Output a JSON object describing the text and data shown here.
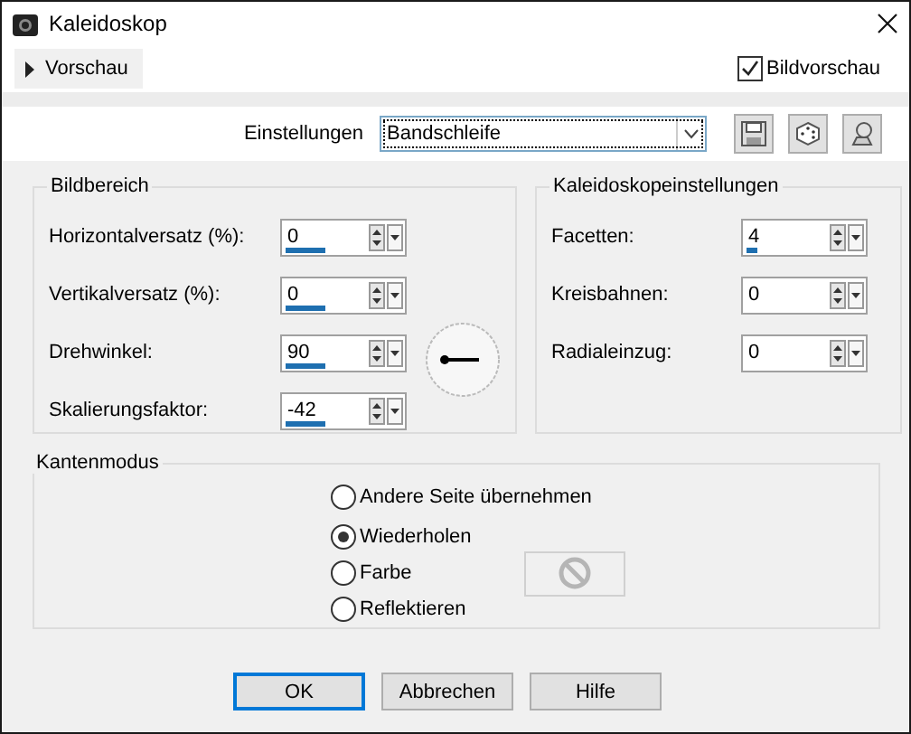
{
  "window": {
    "title": "Kaleidoskop"
  },
  "preview_toggle": {
    "label": "Vorschau",
    "expanded": false
  },
  "image_preview": {
    "label": "Bildvorschau",
    "checked": true
  },
  "presets": {
    "label": "Einstellungen",
    "value": "Bandschleife"
  },
  "image_area": {
    "title": "Bildbereich",
    "fields": [
      {
        "label": "Horizontalversatz (%):",
        "value": "0",
        "kind": "bar"
      },
      {
        "label": "Vertikalversatz (%):",
        "value": "0",
        "kind": "bar"
      },
      {
        "label": "Drehwinkel:",
        "value": "90",
        "kind": "bar"
      },
      {
        "label": "Skalierungsfaktor:",
        "value": "-42",
        "kind": "bar"
      }
    ]
  },
  "kaleidoscope_settings": {
    "title": "Kaleidoskopeinstellungen",
    "fields": [
      {
        "label": "Facetten:",
        "value": "4",
        "level": 0.13
      },
      {
        "label": "Kreisbahnen:",
        "value": "0"
      },
      {
        "label": "Radialeinzug:",
        "value": "0"
      }
    ]
  },
  "edge_mode": {
    "title": "Kantenmodus",
    "options": [
      {
        "label": "Andere Seite übernehmen",
        "selected": false,
        "kind": "plain"
      },
      {
        "label": "Wiederholen",
        "selected": true,
        "kind": "plain"
      },
      {
        "label": "Farbe",
        "selected": false,
        "kind": "color"
      },
      {
        "label": "Reflektieren",
        "selected": false,
        "kind": "plain"
      }
    ]
  },
  "buttons": [
    {
      "label": "OK",
      "default": true
    },
    {
      "label": "Abbrechen",
      "default": false
    },
    {
      "label": "Hilfe",
      "default": false
    }
  ]
}
